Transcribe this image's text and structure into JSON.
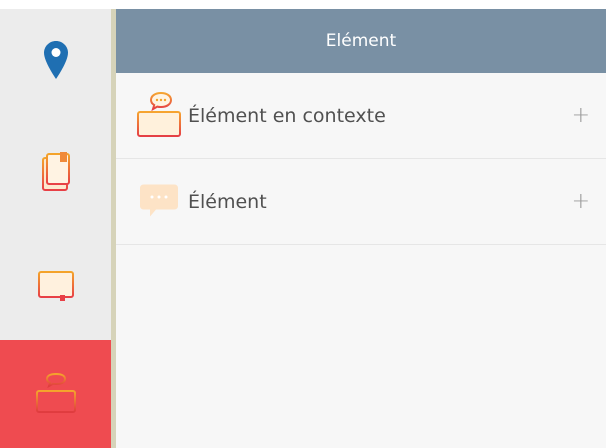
{
  "header": {
    "title": "Elément"
  },
  "rows": [
    {
      "label": "Élément en contexte",
      "action": "+",
      "icon": "book-chat-icon"
    },
    {
      "label": "Élément",
      "action": "+",
      "icon": "chat-bubble-icon"
    }
  ],
  "sidebar": {
    "items": [
      {
        "icon": "map-pin-icon",
        "active": false
      },
      {
        "icon": "document-icon",
        "active": false
      },
      {
        "icon": "open-book-icon",
        "active": false
      },
      {
        "icon": "book-chat-icon",
        "active": true
      }
    ]
  },
  "colors": {
    "header": "#7990a4",
    "active_item": "#ef4b50",
    "sidebar": "#ececec",
    "pin": "#1f6fb2",
    "icon_gradient_start": "#f4a42a",
    "icon_gradient_end": "#e84046"
  }
}
